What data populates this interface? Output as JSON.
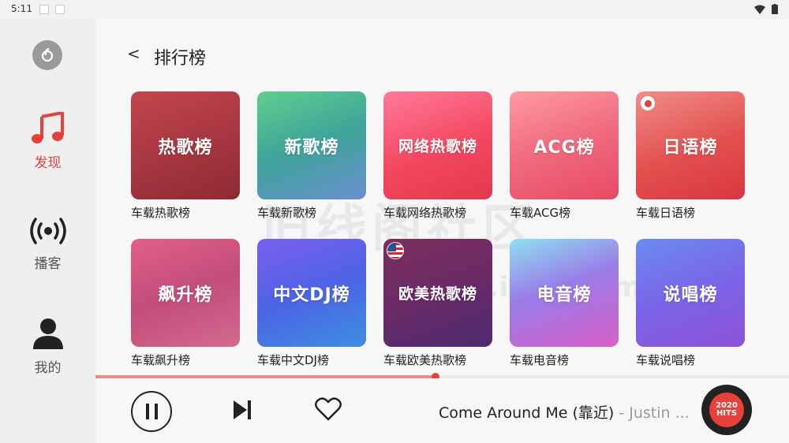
{
  "status": {
    "time": "5:11"
  },
  "sidebar": {
    "items": [
      {
        "label": "发现",
        "icon": "music-note-icon",
        "active": true
      },
      {
        "label": "播客",
        "icon": "podcast-icon",
        "active": false
      },
      {
        "label": "我的",
        "icon": "user-icon",
        "active": false
      }
    ]
  },
  "header": {
    "back": "<",
    "title": "排行榜"
  },
  "charts": [
    {
      "title": "热歌榜",
      "caption": "车载热歌榜"
    },
    {
      "title": "新歌榜",
      "caption": "车载新歌榜"
    },
    {
      "title": "网络热歌榜",
      "caption": "车载网络热歌榜"
    },
    {
      "title": "ACG榜",
      "caption": "车载ACG榜"
    },
    {
      "title": "日语榜",
      "caption": "车载日语榜"
    },
    {
      "title": "飙升榜",
      "caption": "车载飙升榜"
    },
    {
      "title": "中文DJ榜",
      "caption": "车载中文DJ榜"
    },
    {
      "title": "欧美热歌榜",
      "caption": "车载欧美热歌榜"
    },
    {
      "title": "电音榜",
      "caption": "车载电音榜"
    },
    {
      "title": "说唱榜",
      "caption": "车载说唱榜"
    }
  ],
  "watermark": {
    "text": "旧线阁社区",
    "url": "www.i3zh.com"
  },
  "player": {
    "progress": 0.49,
    "song": "Come Around Me (靠近)",
    "artist": " - Justin ...",
    "disc_text": "2020 HITS"
  },
  "colors": {
    "accent": "#e8403a"
  }
}
